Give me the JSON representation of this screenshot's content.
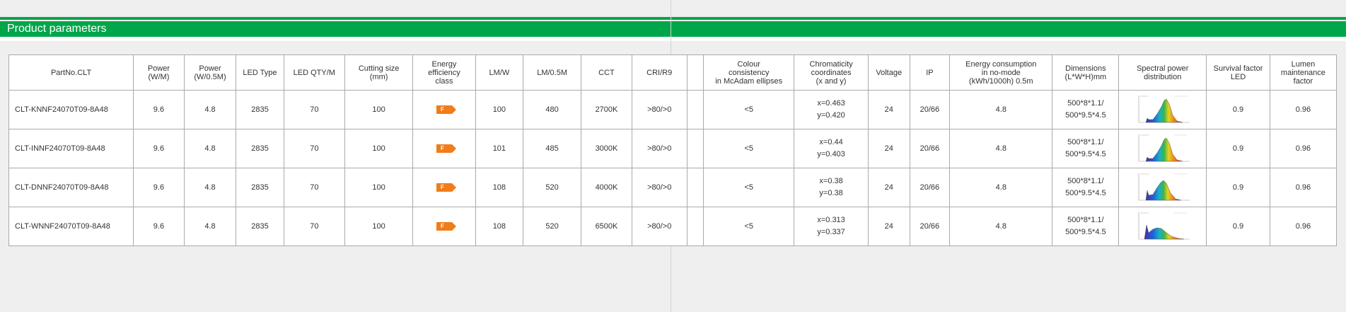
{
  "section_title": "Product parameters",
  "colors": {
    "brand_green": "#00a64a",
    "energy_badge": "#f07c1a"
  },
  "headers": [
    [
      "PartNo.CLT"
    ],
    [
      "Power",
      "(W/M)"
    ],
    [
      "Power",
      "(W/0.5M)"
    ],
    [
      "LED Type"
    ],
    [
      "LED QTY/M"
    ],
    [
      "Cutting size",
      "(mm)"
    ],
    [
      "Energy",
      "efficiency",
      "class"
    ],
    [
      "LM/W"
    ],
    [
      "LM/0.5M"
    ],
    [
      "CCT"
    ],
    [
      "CRI/R9"
    ],
    [
      "Colour",
      "consistency",
      "in McAdam ellipses"
    ],
    [
      "Chromaticity",
      "coordinates",
      "(x and y)"
    ],
    [
      "Voltage"
    ],
    [
      "IP"
    ],
    [
      "Energy consumption",
      "in no-mode",
      "(kWh/1000h) 0.5m"
    ],
    [
      "Dimensions",
      "(L*W*H)mm"
    ],
    [
      "Spectral power",
      "distribution"
    ],
    [
      "Survival factor",
      "LED"
    ],
    [
      "Lumen",
      "maintenance",
      "factor"
    ]
  ],
  "rows": [
    {
      "part": "CLT-KNNF24070T09-8A48",
      "power_m": "9.6",
      "power_half": "4.8",
      "led_type": "2835",
      "led_qty": "70",
      "cutting": "100",
      "energy_class": "F",
      "lm_w": "100",
      "lm_half": "480",
      "cct": "2700K",
      "cri": ">80/>0",
      "mcadam": "<5",
      "chroma_x": "x=0.463",
      "chroma_y": "y=0.420",
      "voltage": "24",
      "ip": "20/66",
      "consumption": "4.8",
      "dim1": "500*8*1.1/",
      "dim2": "500*9.5*4.5",
      "spectral_icon": "spectral-warm-chart-icon",
      "survival": "0.9",
      "lumen_maint": "0.96"
    },
    {
      "part": "CLT-INNF24070T09-8A48",
      "power_m": "9.6",
      "power_half": "4.8",
      "led_type": "2835",
      "led_qty": "70",
      "cutting": "100",
      "energy_class": "F",
      "lm_w": "101",
      "lm_half": "485",
      "cct": "3000K",
      "cri": ">80/>0",
      "mcadam": "<5",
      "chroma_x": "x=0.44",
      "chroma_y": "y=0.403",
      "voltage": "24",
      "ip": "20/66",
      "consumption": "4.8",
      "dim1": "500*8*1.1/",
      "dim2": "500*9.5*4.5",
      "spectral_icon": "spectral-warm-chart-icon",
      "survival": "0.9",
      "lumen_maint": "0.96"
    },
    {
      "part": "CLT-DNNF24070T09-8A48",
      "power_m": "9.6",
      "power_half": "4.8",
      "led_type": "2835",
      "led_qty": "70",
      "cutting": "100",
      "energy_class": "F",
      "lm_w": "108",
      "lm_half": "520",
      "cct": "4000K",
      "cri": ">80/>0",
      "mcadam": "<5",
      "chroma_x": "x=0.38",
      "chroma_y": "y=0.38",
      "voltage": "24",
      "ip": "20/66",
      "consumption": "4.8",
      "dim1": "500*8*1.1/",
      "dim2": "500*9.5*4.5",
      "spectral_icon": "spectral-neutral-chart-icon",
      "survival": "0.9",
      "lumen_maint": "0.96"
    },
    {
      "part": "CLT-WNNF24070T09-8A48",
      "power_m": "9.6",
      "power_half": "4.8",
      "led_type": "2835",
      "led_qty": "70",
      "cutting": "100",
      "energy_class": "F",
      "lm_w": "108",
      "lm_half": "520",
      "cct": "6500K",
      "cri": ">80/>0",
      "mcadam": "<5",
      "chroma_x": "x=0.313",
      "chroma_y": "y=0.337",
      "voltage": "24",
      "ip": "20/66",
      "consumption": "4.8",
      "dim1": "500*8*1.1/",
      "dim2": "500*9.5*4.5",
      "spectral_icon": "spectral-cool-chart-icon",
      "survival": "0.9",
      "lumen_maint": "0.96"
    }
  ]
}
